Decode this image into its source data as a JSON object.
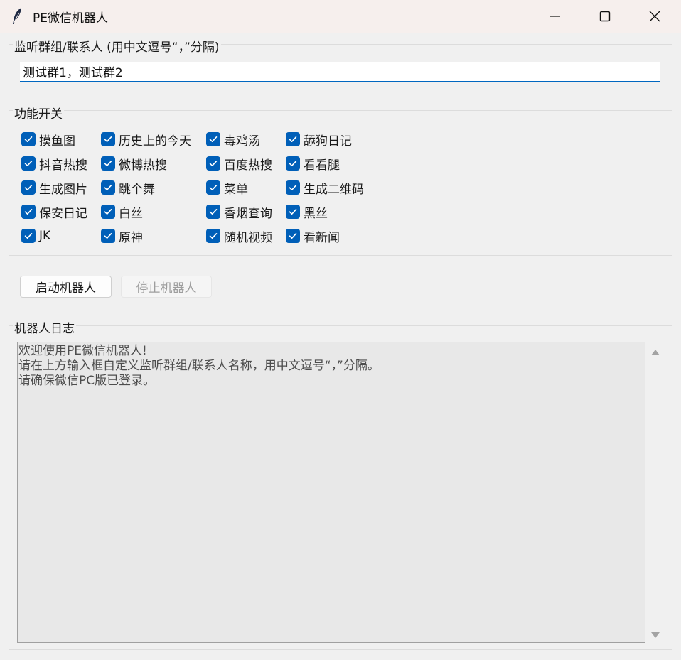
{
  "window": {
    "title": "PE微信机器人",
    "accent_color": "#005fb8"
  },
  "listen_group": {
    "title": "监听群组/联系人 (用中文逗号“，”分隔)",
    "value": "测试群1，测试群2"
  },
  "features": {
    "title": "功能开关",
    "items": [
      {
        "label": "摸鱼图",
        "checked": true
      },
      {
        "label": "历史上的今天",
        "checked": true
      },
      {
        "label": "毒鸡汤",
        "checked": true
      },
      {
        "label": "舔狗日记",
        "checked": true
      },
      {
        "label": "抖音热搜",
        "checked": true
      },
      {
        "label": "微博热搜",
        "checked": true
      },
      {
        "label": "百度热搜",
        "checked": true
      },
      {
        "label": "看看腿",
        "checked": true
      },
      {
        "label": "生成图片",
        "checked": true
      },
      {
        "label": "跳个舞",
        "checked": true
      },
      {
        "label": "菜单",
        "checked": true
      },
      {
        "label": "生成二维码",
        "checked": true
      },
      {
        "label": "保安日记",
        "checked": true
      },
      {
        "label": "白丝",
        "checked": true
      },
      {
        "label": "香烟查询",
        "checked": true
      },
      {
        "label": "黑丝",
        "checked": true
      },
      {
        "label": "JK",
        "checked": true
      },
      {
        "label": "原神",
        "checked": true
      },
      {
        "label": "随机视频",
        "checked": true
      },
      {
        "label": "看新闻",
        "checked": true
      }
    ]
  },
  "buttons": {
    "start": "启动机器人",
    "stop": "停止机器人"
  },
  "log": {
    "title": "机器人日志",
    "text": "欢迎使用PE微信机器人!\n请在上方输入框自定义监听群组/联系人名称，用中文逗号“，”分隔。\n请确保微信PC版已登录。"
  }
}
